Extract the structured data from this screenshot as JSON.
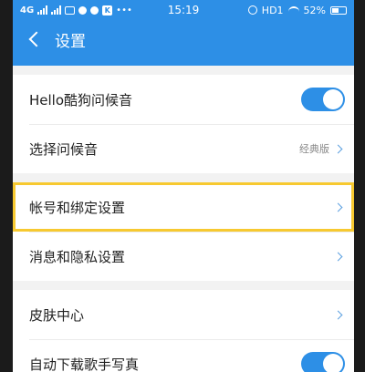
{
  "status_bar": {
    "network": "4G",
    "time": "15:19",
    "hd": "HD1",
    "battery": "52%"
  },
  "nav": {
    "title": "设置"
  },
  "settings": {
    "greeting_sound": {
      "label": "Hello酷狗问候音",
      "toggle_on": true
    },
    "choose_greeting": {
      "label": "选择问候音",
      "value": "经典版"
    },
    "account_binding": {
      "label": "帐号和绑定设置",
      "highlighted": true
    },
    "message_privacy": {
      "label": "消息和隐私设置"
    },
    "skin_center": {
      "label": "皮肤中心"
    },
    "auto_download_photo": {
      "label": "自动下载歌手写真",
      "toggle_on": true
    }
  },
  "colors": {
    "primary": "#2d8fe6",
    "highlight_border": "#f7c930"
  }
}
